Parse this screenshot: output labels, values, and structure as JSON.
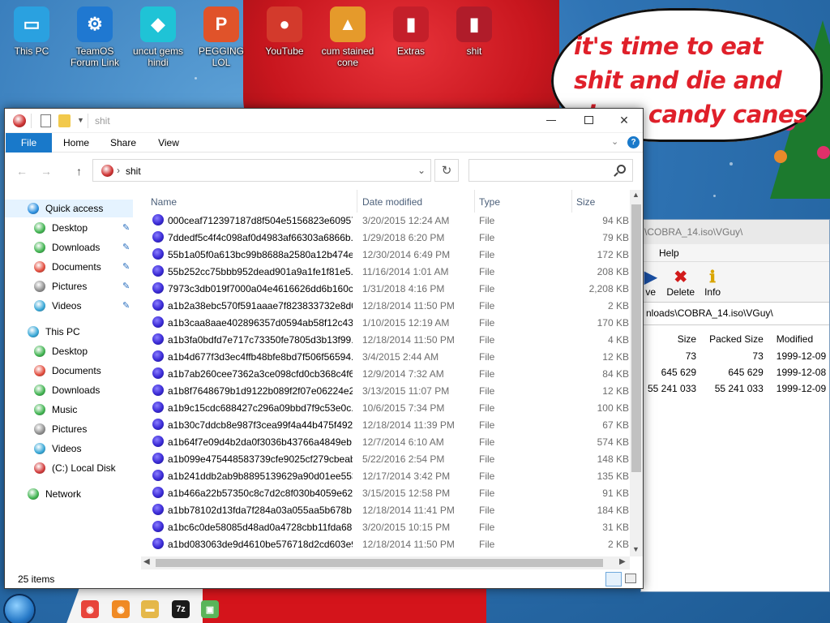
{
  "desktop": {
    "icons": [
      {
        "label": "This PC",
        "color": "#2aa1e0",
        "glyph": "▭"
      },
      {
        "label": "TeamOS Forum Link",
        "color": "#1f78d1",
        "glyph": "⚙"
      },
      {
        "label": "uncut gems hindi",
        "color": "#1fc3d6",
        "glyph": "◆"
      },
      {
        "label": "PEGGING LOL",
        "color": "#e0532a",
        "glyph": "P"
      },
      {
        "label": "YouTube",
        "color": "#d33a2c",
        "glyph": "●"
      },
      {
        "label": "cum stained cone",
        "color": "#e59a2b",
        "glyph": "▲"
      },
      {
        "label": "Extras",
        "color": "#c41f2a",
        "glyph": "▮"
      },
      {
        "label": "shit",
        "color": "#b01c2a",
        "glyph": "▮"
      }
    ],
    "speech_text": "it's time to eat shit and die and chew candy canes"
  },
  "archive": {
    "title": "\\COBRA_14.iso\\VGuy\\",
    "menu_help": "Help",
    "tools": [
      {
        "label": "ve",
        "glyph": "▶",
        "color": "#1a4fa3"
      },
      {
        "label": "Delete",
        "glyph": "✖",
        "color": "#d21b1b"
      },
      {
        "label": "Info",
        "glyph": "ℹ",
        "color": "#d9a500"
      }
    ],
    "address": "nloads\\COBRA_14.iso\\VGuy\\",
    "columns": {
      "size": "Size",
      "packed": "Packed Size",
      "modified": "Modified"
    },
    "rows": [
      {
        "size": "73",
        "packed": "73",
        "modified": "1999-12-09"
      },
      {
        "size": "645 629",
        "packed": "645 629",
        "modified": "1999-12-08"
      },
      {
        "size": "55 241 033",
        "packed": "55 241 033",
        "modified": "1999-12-09"
      }
    ]
  },
  "explorer": {
    "title": "shit",
    "tabs": {
      "file": "File",
      "home": "Home",
      "share": "Share",
      "view": "View"
    },
    "breadcrumb": "shit",
    "search_placeholder": "",
    "nav": {
      "quick_access": "Quick access",
      "qa_items": [
        "Desktop",
        "Downloads",
        "Documents",
        "Pictures",
        "Videos"
      ],
      "this_pc": "This PC",
      "pc_items": [
        "Desktop",
        "Documents",
        "Downloads",
        "Music",
        "Pictures",
        "Videos",
        "(C:) Local Disk"
      ],
      "network": "Network"
    },
    "columns": {
      "name": "Name",
      "date": "Date modified",
      "type": "Type",
      "size": "Size"
    },
    "files": [
      {
        "name": "000ceaf712397187d8f504e5156823e60957f...",
        "date": "3/20/2015 12:24 AM",
        "type": "File",
        "size": "94 KB"
      },
      {
        "name": "7ddedf5c4f4c098af0d4983af66303a6866b...",
        "date": "1/29/2018 6:20 PM",
        "type": "File",
        "size": "79 KB"
      },
      {
        "name": "55b1a05f0a613bc99b8688a2580a12b474e...",
        "date": "12/30/2014 6:49 PM",
        "type": "File",
        "size": "172 KB"
      },
      {
        "name": "55b252cc75bbb952dead901a9a1fe1f81e5...",
        "date": "11/16/2014 1:01 AM",
        "type": "File",
        "size": "208 KB"
      },
      {
        "name": "7973c3db019f7000a04e4616626dd6b160c...",
        "date": "1/31/2018 4:16 PM",
        "type": "File",
        "size": "2,208 KB"
      },
      {
        "name": "a1b2a38ebc570f591aaae7f823833732e8d0...",
        "date": "12/18/2014 11:50 PM",
        "type": "File",
        "size": "2 KB"
      },
      {
        "name": "a1b3caa8aae402896357d0594ab58f12c43f...",
        "date": "1/10/2015 12:19 AM",
        "type": "File",
        "size": "170 KB"
      },
      {
        "name": "a1b3fa0bdfd7e717c73350fe7805d3b13f99...",
        "date": "12/18/2014 11:50 PM",
        "type": "File",
        "size": "4 KB"
      },
      {
        "name": "a1b4d677f3d3ec4ffb48bfe8bd7f506f56594...",
        "date": "3/4/2015 2:44 AM",
        "type": "File",
        "size": "12 KB"
      },
      {
        "name": "a1b7ab260cee7362a3ce098cfd0cb368c4f6...",
        "date": "12/9/2014 7:32 AM",
        "type": "File",
        "size": "84 KB"
      },
      {
        "name": "a1b8f7648679b1d9122b089f2f07e06224e2...",
        "date": "3/13/2015 11:07 PM",
        "type": "File",
        "size": "12 KB"
      },
      {
        "name": "a1b9c15cdc688427c296a09bbd7f9c53e0c...",
        "date": "10/6/2015 7:34 PM",
        "type": "File",
        "size": "100 KB"
      },
      {
        "name": "a1b30c7ddcb8e987f3cea99f4a44b475f492...",
        "date": "12/18/2014 11:39 PM",
        "type": "File",
        "size": "67 KB"
      },
      {
        "name": "a1b64f7e09d4b2da0f3036b43766a4849eb...",
        "date": "12/7/2014 6:10 AM",
        "type": "File",
        "size": "574 KB"
      },
      {
        "name": "a1b099e475448583739cfe9025cf279cbeab...",
        "date": "5/22/2016 2:54 PM",
        "type": "File",
        "size": "148 KB"
      },
      {
        "name": "a1b241ddb2ab9b8895139629a90d01ee553...",
        "date": "12/17/2014 3:42 PM",
        "type": "File",
        "size": "135 KB"
      },
      {
        "name": "a1b466a22b57350c8c7d2c8f030b4059e62...",
        "date": "3/15/2015 12:58 PM",
        "type": "File",
        "size": "91 KB"
      },
      {
        "name": "a1bb78102d13fda7f284a03a055aa5b678b...",
        "date": "12/18/2014 11:41 PM",
        "type": "File",
        "size": "184 KB"
      },
      {
        "name": "a1bc6c0de58085d48ad0a4728cbb11fda68...",
        "date": "3/20/2015 10:15 PM",
        "type": "File",
        "size": "31 KB"
      },
      {
        "name": "a1bd083063de9d4610be576718d2cd603e9...",
        "date": "12/18/2014 11:50 PM",
        "type": "File",
        "size": "2 KB"
      }
    ],
    "status": "25 items"
  },
  "taskbar": {
    "buttons": [
      {
        "name": "chrome-taskbar-button",
        "color": "#e8453c",
        "glyph": "◉"
      },
      {
        "name": "firefox-taskbar-button",
        "color": "#f08a24",
        "glyph": "◉"
      },
      {
        "name": "explorer-taskbar-button",
        "color": "#e5b84a",
        "glyph": "▬"
      },
      {
        "name": "7zip-taskbar-button",
        "color": "#1a1a1a",
        "glyph": "7z"
      },
      {
        "name": "paint-taskbar-button",
        "color": "#5ab55a",
        "glyph": "▣"
      }
    ]
  },
  "accent": "#1979ca"
}
